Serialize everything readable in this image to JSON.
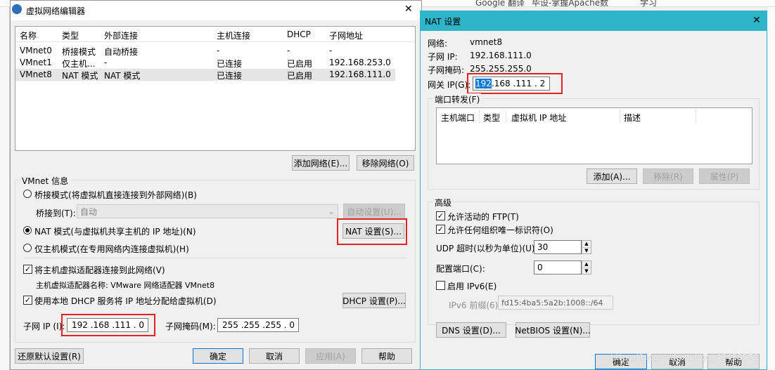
{
  "topbar": {
    "items": [
      "Google 翻译",
      "毕设-掌握Apache数",
      "学习"
    ]
  },
  "left_dialog": {
    "title": "虚拟网络编辑器",
    "columns": [
      "名称",
      "类型",
      "外部连接",
      "主机连接",
      "DHCP",
      "子网地址"
    ],
    "rows": [
      [
        "VMnet0",
        "桥接模式",
        "自动桥接",
        "-",
        "-",
        "-"
      ],
      [
        "VMnet1",
        "仅主机...",
        "-",
        "已连接",
        "已启用",
        "192.168.253.0"
      ],
      [
        "VMnet8",
        "NAT 模式",
        "NAT 模式",
        "已连接",
        "已启用",
        "192.168.111.0"
      ]
    ],
    "add_network": "添加网络(E)...",
    "remove_network": "移除网络(O)",
    "vmnet_info": "VMnet 信息",
    "bridge_mode": "桥接模式(将虚拟机直接连接到外部网络)(B)",
    "bridged_to": "桥接到(T):",
    "bridged_value": "自动",
    "auto_settings": "自动设置(U)...",
    "nat_mode": "NAT 模式(与虚拟机共享主机的 IP 地址)(N)",
    "nat_settings": "NAT 设置(S)...",
    "host_only": "仅主机模式(在专用网络内连接虚拟机)(H)",
    "connect_adapter": "将主机虚拟适配器连接到此网络(V)",
    "adapter_name": "主机虚拟适配器名称: VMware 网络适配器 VMnet8",
    "use_dhcp": "使用本地 DHCP 服务将 IP 地址分配给虚拟机(D)",
    "dhcp_settings": "DHCP 设置(P)...",
    "subnet_ip_label": "子网 IP (I):",
    "subnet_ip": "192 .168 .111 . 0",
    "subnet_mask_label": "子网掩码(M):",
    "subnet_mask": "255 .255 .255 . 0",
    "restore": "还原默认设置(R)",
    "ok": "确定",
    "cancel": "取消",
    "apply": "应用(A)",
    "help": "帮助"
  },
  "nat_dialog": {
    "title": "NAT 设置",
    "network_label": "网络:",
    "network": "vmnet8",
    "subnet_ip_label": "子网 IP:",
    "subnet_ip": "192.168.111.0",
    "subnet_mask_label": "子网掩码:",
    "subnet_mask": "255.255.255.0",
    "gateway_label": "网关 IP(G):",
    "gateway_ip_sel": "192",
    "gateway_ip_rest": " .168 .111 . 2",
    "port_forward": "端口转发(F)",
    "pf_columns": [
      "主机端口",
      "类型",
      "虚拟机 IP 地址",
      "描述"
    ],
    "add": "添加(A)...",
    "remove": "移除(R)",
    "properties": "属性(P)",
    "advanced": "高级",
    "allow_ftp": "允许活动的 FTP(T)",
    "allow_uid": "允许任何组织唯一标识符(O)",
    "udp_label": "UDP 超时(以秒为单位)(U):",
    "udp_value": "30",
    "config_port_label": "配置端口(C):",
    "config_port_value": "0",
    "enable_ipv6": "启用 IPv6(E)",
    "ipv6_prefix_label": "IPv6 前缀(6):",
    "ipv6_prefix": "fd15:4ba5:5a2b:1008::/64",
    "dns": "DNS 设置(D)...",
    "netbios": "NetBIOS 设置(N)...",
    "ok": "确定",
    "cancel": "取消",
    "help": "帮助",
    "watermark": "https://blog.csdn.net/qq_43458572"
  },
  "colors": {
    "accent": "#0078d7",
    "nat_title_bg": "#2fb5c9",
    "highlight": "#e02424"
  }
}
